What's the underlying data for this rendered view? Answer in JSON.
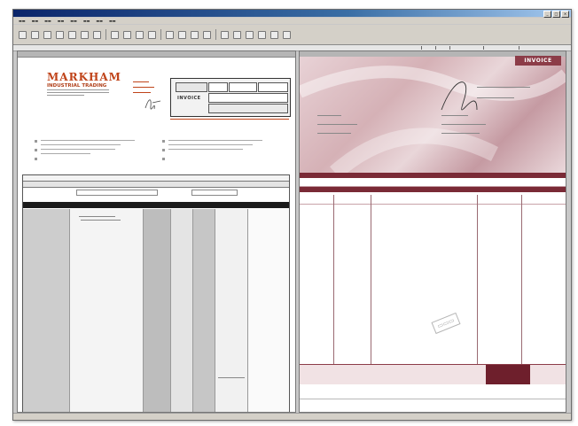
{
  "left_doc": {
    "brand_name": "MARKHAM",
    "brand_sub": "INDUSTRIAL TRADING",
    "invoice_label": "INVOICE"
  },
  "right_doc": {
    "title": "INVOICE"
  },
  "colors": {
    "brand": "#c0441a",
    "invoice_accent": "#7a2a36"
  }
}
